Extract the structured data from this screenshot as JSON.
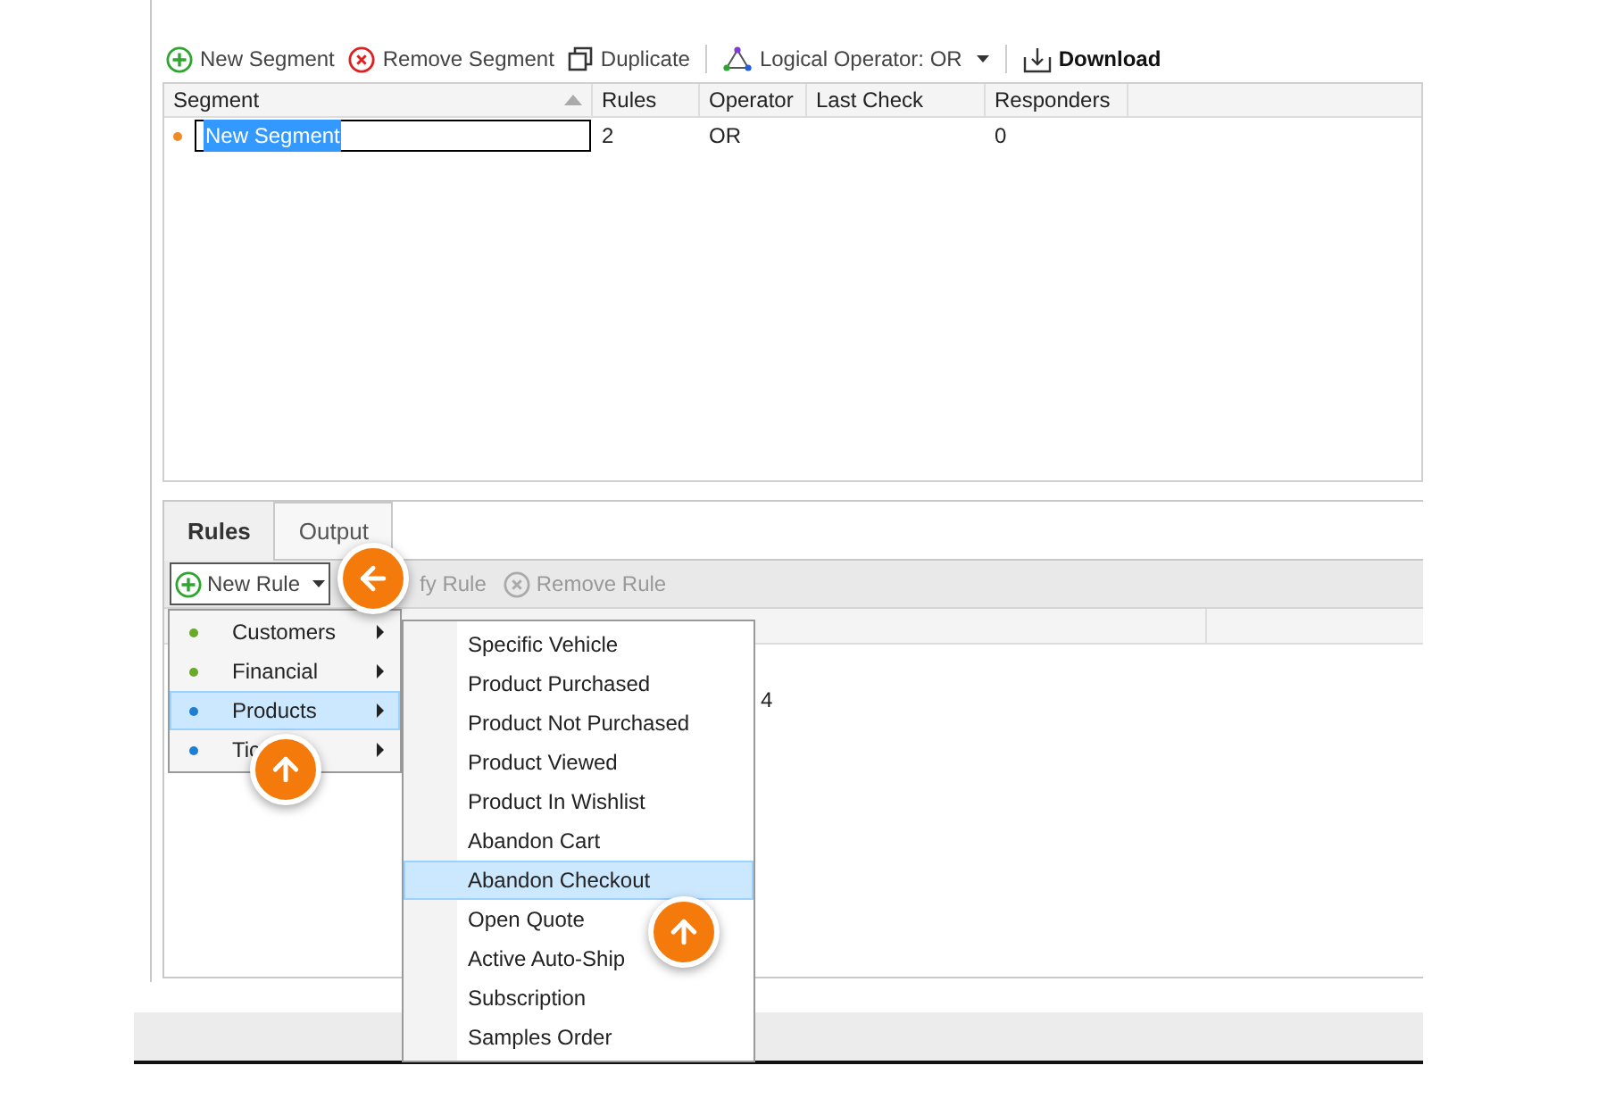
{
  "toolbar": [
    {
      "kind": "add",
      "label": "New Segment"
    },
    {
      "kind": "remove",
      "label": "Remove Segment"
    },
    {
      "kind": "duplicate",
      "label": "Duplicate"
    },
    {
      "kind": "operator",
      "label": "Logical Operator: OR"
    },
    {
      "kind": "download",
      "label": "Download"
    }
  ],
  "table": {
    "columns": [
      {
        "label": "Segment",
        "sorted": true
      },
      {
        "label": "Rules",
        "sorted": false
      },
      {
        "label": "Operator",
        "sorted": false
      },
      {
        "label": "Last Check",
        "sorted": false
      },
      {
        "label": "Responders",
        "sorted": false
      }
    ],
    "rows": [
      {
        "color": "#f08a24",
        "name": "New Segment",
        "editing": true,
        "rules": "2",
        "operator": "OR",
        "responders": "0"
      }
    ]
  },
  "tabs": [
    {
      "label": "Rules",
      "selected": true
    },
    {
      "label": "Output",
      "selected": false
    }
  ],
  "rules_toolbar": [
    {
      "kind": "add",
      "label": "New Rule",
      "open": true
    },
    {
      "kind": "modify",
      "label": "fy Rule"
    },
    {
      "kind": "remove",
      "label": "Remove Rule"
    }
  ],
  "rules_grid": {
    "cell": "4"
  },
  "category_menu": [
    {
      "label": "Customers",
      "color": "#6aaa2a",
      "selected": false
    },
    {
      "label": "Financial",
      "color": "#6aaa2a",
      "selected": false
    },
    {
      "label": "Products",
      "color": "#1e7fd0",
      "selected": true
    },
    {
      "label": "Tic",
      "color": "#1e7fd0",
      "selected": false
    }
  ],
  "submenu": [
    {
      "label": "Specific Vehicle",
      "selected": false
    },
    {
      "label": "Product Purchased",
      "selected": false
    },
    {
      "label": "Product Not Purchased",
      "selected": false
    },
    {
      "label": "Product Viewed",
      "selected": false
    },
    {
      "label": "Product In Wishlist",
      "selected": false
    },
    {
      "label": "Abandon Cart",
      "selected": false
    },
    {
      "label": "Abandon Checkout",
      "selected": true
    },
    {
      "label": "Open Quote",
      "selected": false
    },
    {
      "label": "Active Auto-Ship",
      "selected": false
    },
    {
      "label": "Subscription",
      "selected": false
    },
    {
      "label": "Samples Order",
      "selected": false
    }
  ],
  "callouts": [
    {
      "kind": "left"
    },
    {
      "kind": "up"
    },
    {
      "kind": "up"
    }
  ]
}
